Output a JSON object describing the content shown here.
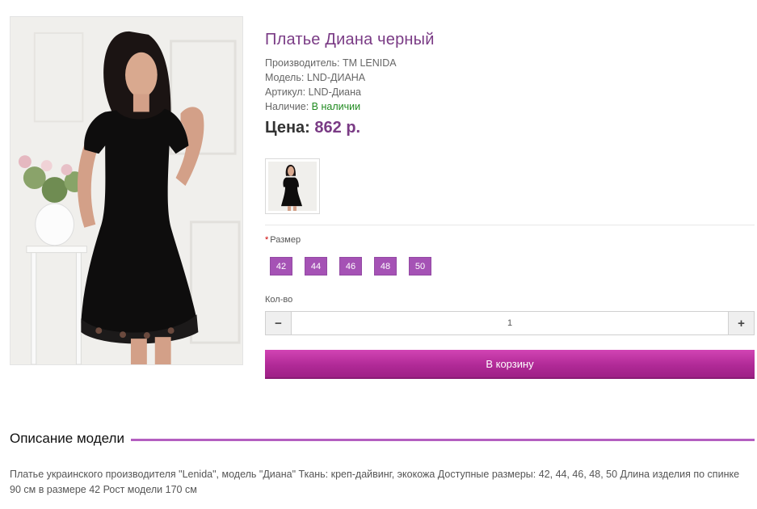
{
  "product": {
    "title": "Платье Диана черный",
    "manufacturer_label": "Производитель:",
    "manufacturer": "ТМ LENIDA",
    "model_label": "Модель:",
    "model": "LND-ДИАНА",
    "sku_label": "Артикул:",
    "sku": "LND-Диана",
    "availability_label": "Наличие:",
    "availability": "В наличии",
    "price_label": "Цена:",
    "price": "862 р."
  },
  "options": {
    "required_mark": "*",
    "size_label": "Размер",
    "sizes": [
      "42",
      "44",
      "46",
      "48",
      "50"
    ]
  },
  "quantity": {
    "label": "Кол-во",
    "value": "1",
    "minus_icon": "minus-icon",
    "plus_icon": "plus-icon"
  },
  "cart": {
    "button_label": "В корзину"
  },
  "description": {
    "heading": "Описание модели",
    "text": "Платье украинского производителя \"Lenida\", модель \"Диана\" Ткань: креп-дайвинг, экокожа Доступные размеры: 42, 44, 46, 48, 50 Длина изделия по спинке 90 см в размере 42 Рост модели 170 см"
  },
  "colors": {
    "accent": "#7a3b85",
    "size_button": "#a552b5",
    "cart_button": "#b12a97",
    "in_stock": "#1f8a1f"
  }
}
